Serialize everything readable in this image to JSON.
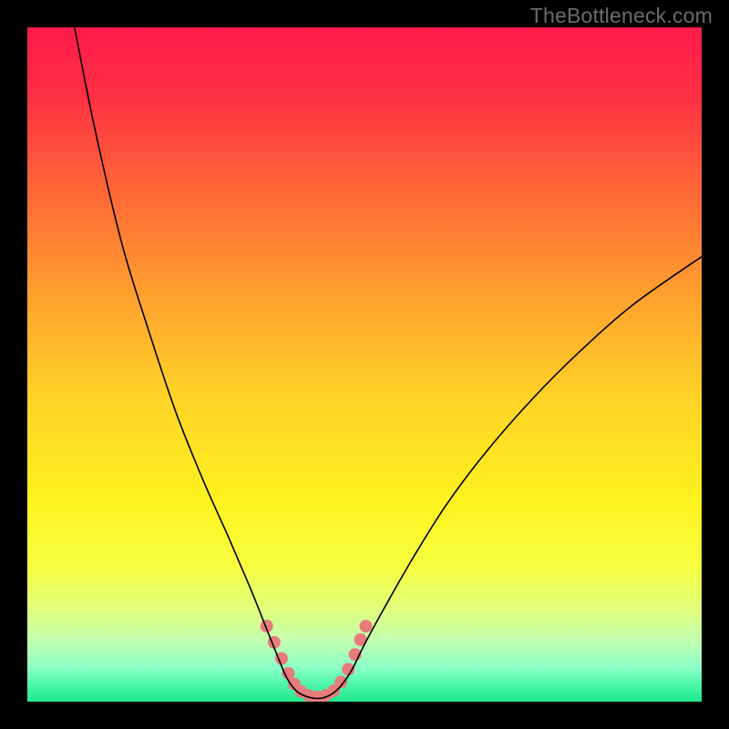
{
  "watermark": "TheBottleneck.com",
  "chart_data": {
    "type": "line",
    "title": "",
    "xlabel": "",
    "ylabel": "",
    "xlim": [
      0,
      100
    ],
    "ylim": [
      0,
      100
    ],
    "grid": false,
    "legend": false,
    "gradient_stops": [
      {
        "offset": 0.0,
        "color": "#ff1a4b"
      },
      {
        "offset": 0.1,
        "color": "#ff2f44"
      },
      {
        "offset": 0.25,
        "color": "#ff6a36"
      },
      {
        "offset": 0.4,
        "color": "#ffa12e"
      },
      {
        "offset": 0.55,
        "color": "#ffd326"
      },
      {
        "offset": 0.7,
        "color": "#fff21e"
      },
      {
        "offset": 0.8,
        "color": "#f6ff40"
      },
      {
        "offset": 0.86,
        "color": "#e3ff7a"
      },
      {
        "offset": 0.91,
        "color": "#c2ffb0"
      },
      {
        "offset": 0.95,
        "color": "#8bffc8"
      },
      {
        "offset": 0.975,
        "color": "#4cf7a8"
      },
      {
        "offset": 1.0,
        "color": "#1fe88f"
      }
    ],
    "series": [
      {
        "name": "bottleneck-curve",
        "color": "#000000",
        "width": 1.6,
        "points": [
          {
            "x": 7.0,
            "y": 100.0
          },
          {
            "x": 10.0,
            "y": 85.0
          },
          {
            "x": 14.0,
            "y": 68.0
          },
          {
            "x": 18.0,
            "y": 55.0
          },
          {
            "x": 22.0,
            "y": 43.0
          },
          {
            "x": 26.0,
            "y": 33.0
          },
          {
            "x": 30.0,
            "y": 24.0
          },
          {
            "x": 33.0,
            "y": 17.0
          },
          {
            "x": 35.0,
            "y": 12.0
          },
          {
            "x": 37.0,
            "y": 7.0
          },
          {
            "x": 38.5,
            "y": 3.5
          },
          {
            "x": 40.0,
            "y": 1.5
          },
          {
            "x": 42.0,
            "y": 0.6
          },
          {
            "x": 44.0,
            "y": 0.6
          },
          {
            "x": 46.0,
            "y": 1.8
          },
          {
            "x": 48.0,
            "y": 4.5
          },
          {
            "x": 50.0,
            "y": 8.5
          },
          {
            "x": 53.0,
            "y": 14.0
          },
          {
            "x": 57.0,
            "y": 21.0
          },
          {
            "x": 62.0,
            "y": 29.0
          },
          {
            "x": 68.0,
            "y": 37.0
          },
          {
            "x": 75.0,
            "y": 45.0
          },
          {
            "x": 82.0,
            "y": 52.0
          },
          {
            "x": 90.0,
            "y": 59.0
          },
          {
            "x": 100.0,
            "y": 66.0
          }
        ]
      }
    ],
    "markers": {
      "color": "#e87b7b",
      "radius": 7,
      "points": [
        {
          "x": 35.5,
          "y": 11.2
        },
        {
          "x": 36.6,
          "y": 8.8
        },
        {
          "x": 37.7,
          "y": 6.4
        },
        {
          "x": 38.7,
          "y": 4.2
        },
        {
          "x": 39.6,
          "y": 2.6
        },
        {
          "x": 40.6,
          "y": 1.5
        },
        {
          "x": 41.8,
          "y": 0.9
        },
        {
          "x": 43.0,
          "y": 0.7
        },
        {
          "x": 44.2,
          "y": 0.9
        },
        {
          "x": 45.4,
          "y": 1.6
        },
        {
          "x": 46.5,
          "y": 2.9
        },
        {
          "x": 47.6,
          "y": 4.8
        },
        {
          "x": 48.6,
          "y": 7.0
        },
        {
          "x": 49.4,
          "y": 9.2
        },
        {
          "x": 50.2,
          "y": 11.2
        }
      ]
    }
  }
}
